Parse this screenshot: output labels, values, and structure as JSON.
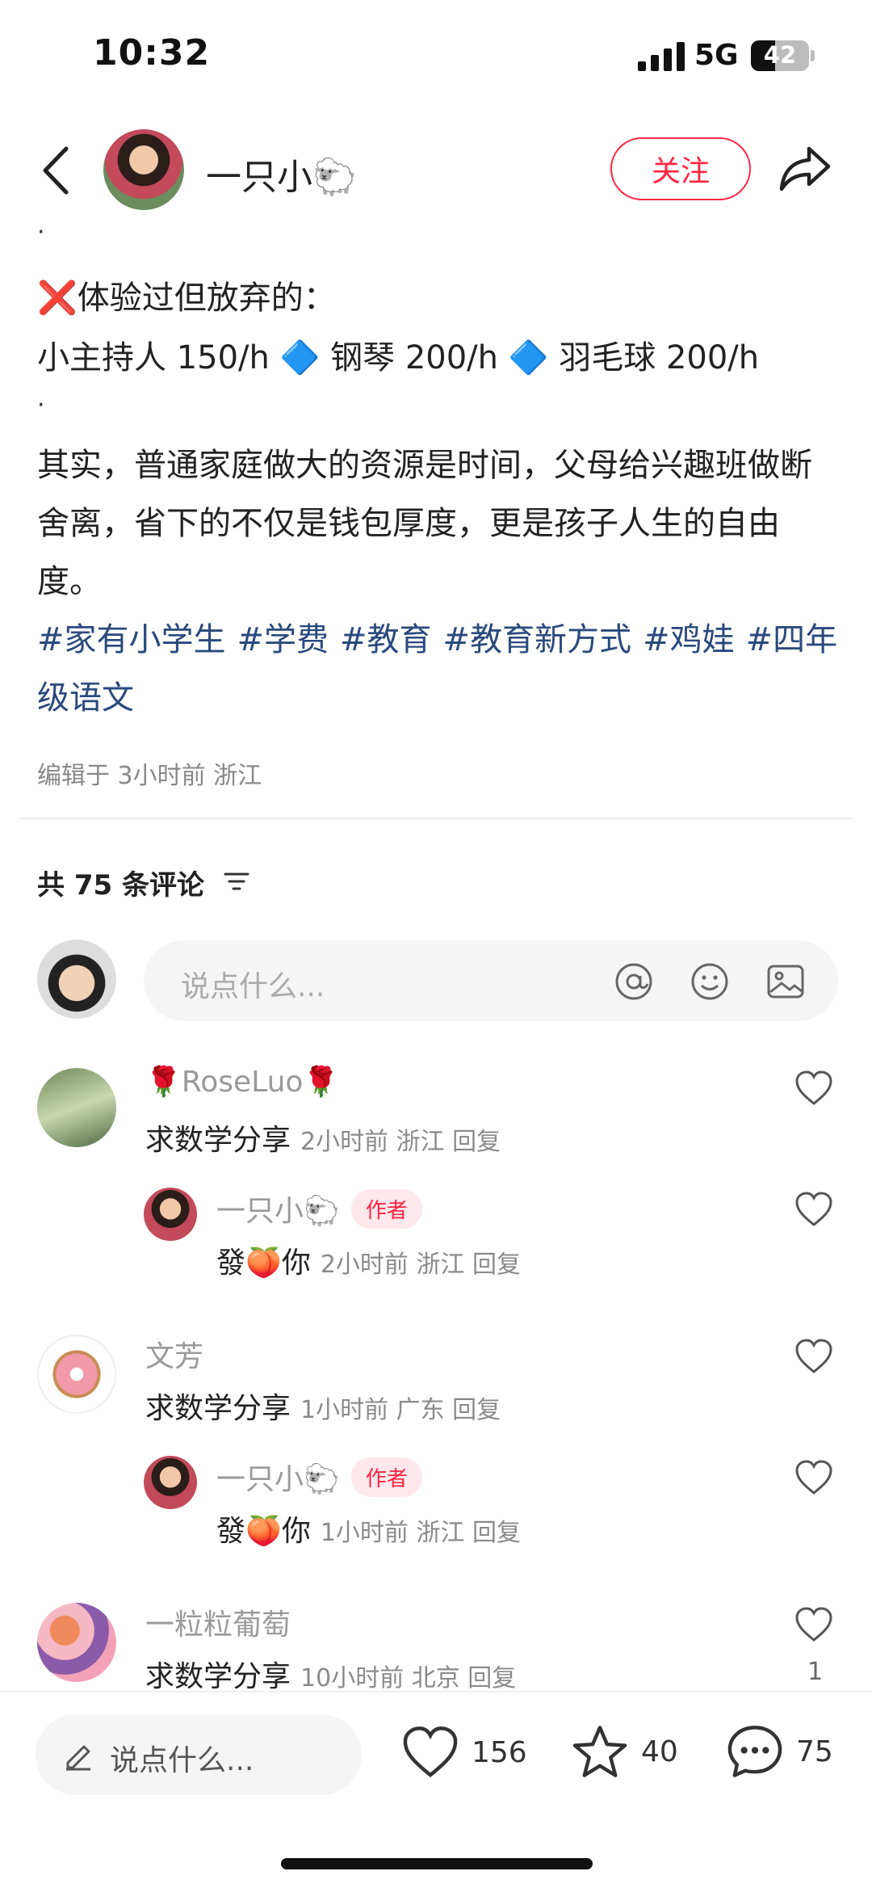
{
  "status_bar": {
    "time": "10:32",
    "network": "5G",
    "battery": "42"
  },
  "header": {
    "author": "一只小🐑",
    "follow_label": "关注"
  },
  "post": {
    "dot1": "·",
    "gave_up_title": "❌体验过但放弃的：",
    "gave_up_items": "小主持人 150/h 🔷 钢琴 200/h 🔷 羽毛球 200/h",
    "dot2": "·",
    "paragraph": "其实，普通家庭做大的资源是时间，父母给兴趣班做断舍离，省下的不仅是钱包厚度，更是孩子人生的自由度。",
    "tags": [
      "#家有小学生",
      "#学费",
      "#教育",
      "#教育新方式",
      "#鸡娃",
      "#四年级语文"
    ],
    "edit_meta": "编辑于 3小时前 浙江"
  },
  "comments_header": {
    "count_label": "共 75 条评论"
  },
  "comment_input": {
    "placeholder": "说点什么..."
  },
  "comments": [
    {
      "name": "🌹RoseLuo🌹",
      "text": "求数学分享",
      "meta": "2小时前 浙江 回复",
      "reply": {
        "name": "一只小🐑",
        "badge": "作者",
        "text": "發🍑你",
        "meta": "2小时前 浙江 回复"
      }
    },
    {
      "name": "文芳",
      "text": "求数学分享",
      "meta": "1小时前 广东 回复",
      "reply": {
        "name": "一只小🐑",
        "badge": "作者",
        "text": "發🍑你",
        "meta": "1小时前 浙江 回复"
      }
    },
    {
      "name": "一粒粒葡萄",
      "text": "求数学分享",
      "meta": "10小时前 北京 回复",
      "likes": "1"
    }
  ],
  "bottom_bar": {
    "placeholder": "说点什么...",
    "likes": "156",
    "stars": "40",
    "comments": "75"
  },
  "colors": {
    "accent": "#ff2442",
    "tag": "#2a4a7d"
  },
  "icons": [
    "back-icon",
    "share-icon",
    "sort-icon",
    "at-icon",
    "emoji-icon",
    "image-icon",
    "heart-icon",
    "star-icon",
    "comment-icon",
    "pencil-icon"
  ]
}
